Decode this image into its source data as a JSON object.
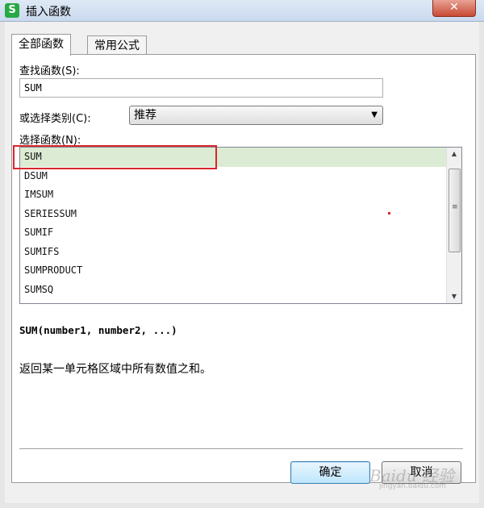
{
  "window": {
    "app_icon_glyph": "S",
    "title": "插入函数",
    "close_glyph": "✕"
  },
  "tabs": [
    {
      "label": "全部函数",
      "active": true
    },
    {
      "label": "常用公式",
      "active": false
    }
  ],
  "search": {
    "label": "查找函数(S):",
    "value": "SUM"
  },
  "category": {
    "label": "或选择类别(C):",
    "selected": "推荐"
  },
  "function_list": {
    "label": "选择函数(N):",
    "items": [
      "SUM",
      "DSUM",
      "IMSUM",
      "SERIESSUM",
      "SUMIF",
      "SUMIFS",
      "SUMPRODUCT",
      "SUMSQ"
    ],
    "selected_index": 0
  },
  "signature": "SUM(number1, number2, ...)",
  "description": "返回某一单元格区域中所有数值之和。",
  "buttons": {
    "ok": "确定",
    "cancel": "取消"
  },
  "watermark": {
    "text": "Baidu 经验",
    "sub": "jingyan.baidu.com"
  },
  "colors": {
    "selected_row": "#dcebd3",
    "annotation_red": "#d9262e",
    "app_icon_green": "#27a844"
  }
}
